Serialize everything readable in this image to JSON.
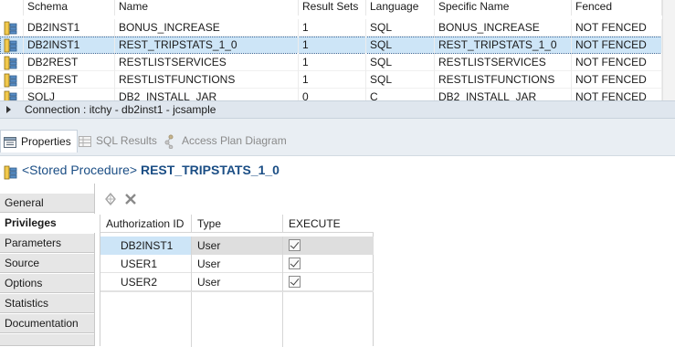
{
  "procedures": {
    "columns": [
      "Schema",
      "Name",
      "Result Sets",
      "Language",
      "Specific Name",
      "Fenced"
    ],
    "rows": [
      {
        "schema": "DB2INST1",
        "name": "BONUS_INCREASE",
        "result_sets": "1",
        "language": "SQL",
        "specific_name": "BONUS_INCREASE",
        "fenced": "NOT FENCED"
      },
      {
        "schema": "DB2INST1",
        "name": "REST_TRIPSTATS_1_0",
        "result_sets": "1",
        "language": "SQL",
        "specific_name": "REST_TRIPSTATS_1_0",
        "fenced": "NOT FENCED"
      },
      {
        "schema": "DB2REST",
        "name": "RESTLISTSERVICES",
        "result_sets": "1",
        "language": "SQL",
        "specific_name": "RESTLISTSERVICES",
        "fenced": "NOT FENCED"
      },
      {
        "schema": "DB2REST",
        "name": "RESTLISTFUNCTIONS",
        "result_sets": "1",
        "language": "SQL",
        "specific_name": "RESTLISTFUNCTIONS",
        "fenced": "NOT FENCED"
      },
      {
        "schema": "SQLJ",
        "name": "DB2_INSTALL_JAR",
        "result_sets": "0",
        "language": "C",
        "specific_name": "DB2_INSTALL_JAR",
        "fenced": "NOT FENCED"
      }
    ],
    "selected_index": 1
  },
  "connection": {
    "label": "Connection : itchy - db2inst1 - jcsample"
  },
  "view_tabs": [
    {
      "label": "Properties",
      "icon": "properties-icon",
      "active": true
    },
    {
      "label": "SQL Results",
      "icon": "sql-results-icon",
      "active": false
    },
    {
      "label": "Access Plan Diagram",
      "icon": "access-plan-icon",
      "active": false
    }
  ],
  "properties": {
    "object_type": "<Stored Procedure>",
    "object_name": "REST_TRIPSTATS_1_0"
  },
  "categories": [
    {
      "label": "General",
      "active": false
    },
    {
      "label": "Privileges",
      "active": true
    },
    {
      "label": "Parameters",
      "active": false
    },
    {
      "label": "Source",
      "active": false
    },
    {
      "label": "Options",
      "active": false
    },
    {
      "label": "Statistics",
      "active": false
    },
    {
      "label": "Documentation",
      "active": false
    }
  ],
  "privileges": {
    "toolbar": {
      "grant_icon": "grant-icon",
      "revoke_icon": "delete-x-icon"
    },
    "columns": [
      "Authorization ID",
      "Type",
      "EXECUTE"
    ],
    "rows": [
      {
        "auth_id": "DB2INST1",
        "type": "User",
        "execute": true
      },
      {
        "auth_id": "USER1",
        "type": "User",
        "execute": true
      },
      {
        "auth_id": "USER2",
        "type": "User",
        "execute": true
      }
    ],
    "selected_index": 0
  },
  "colors": {
    "accent_blue": "#1b4e85",
    "selection": "#cde5f7",
    "tab_bar": "#e9eef3"
  }
}
